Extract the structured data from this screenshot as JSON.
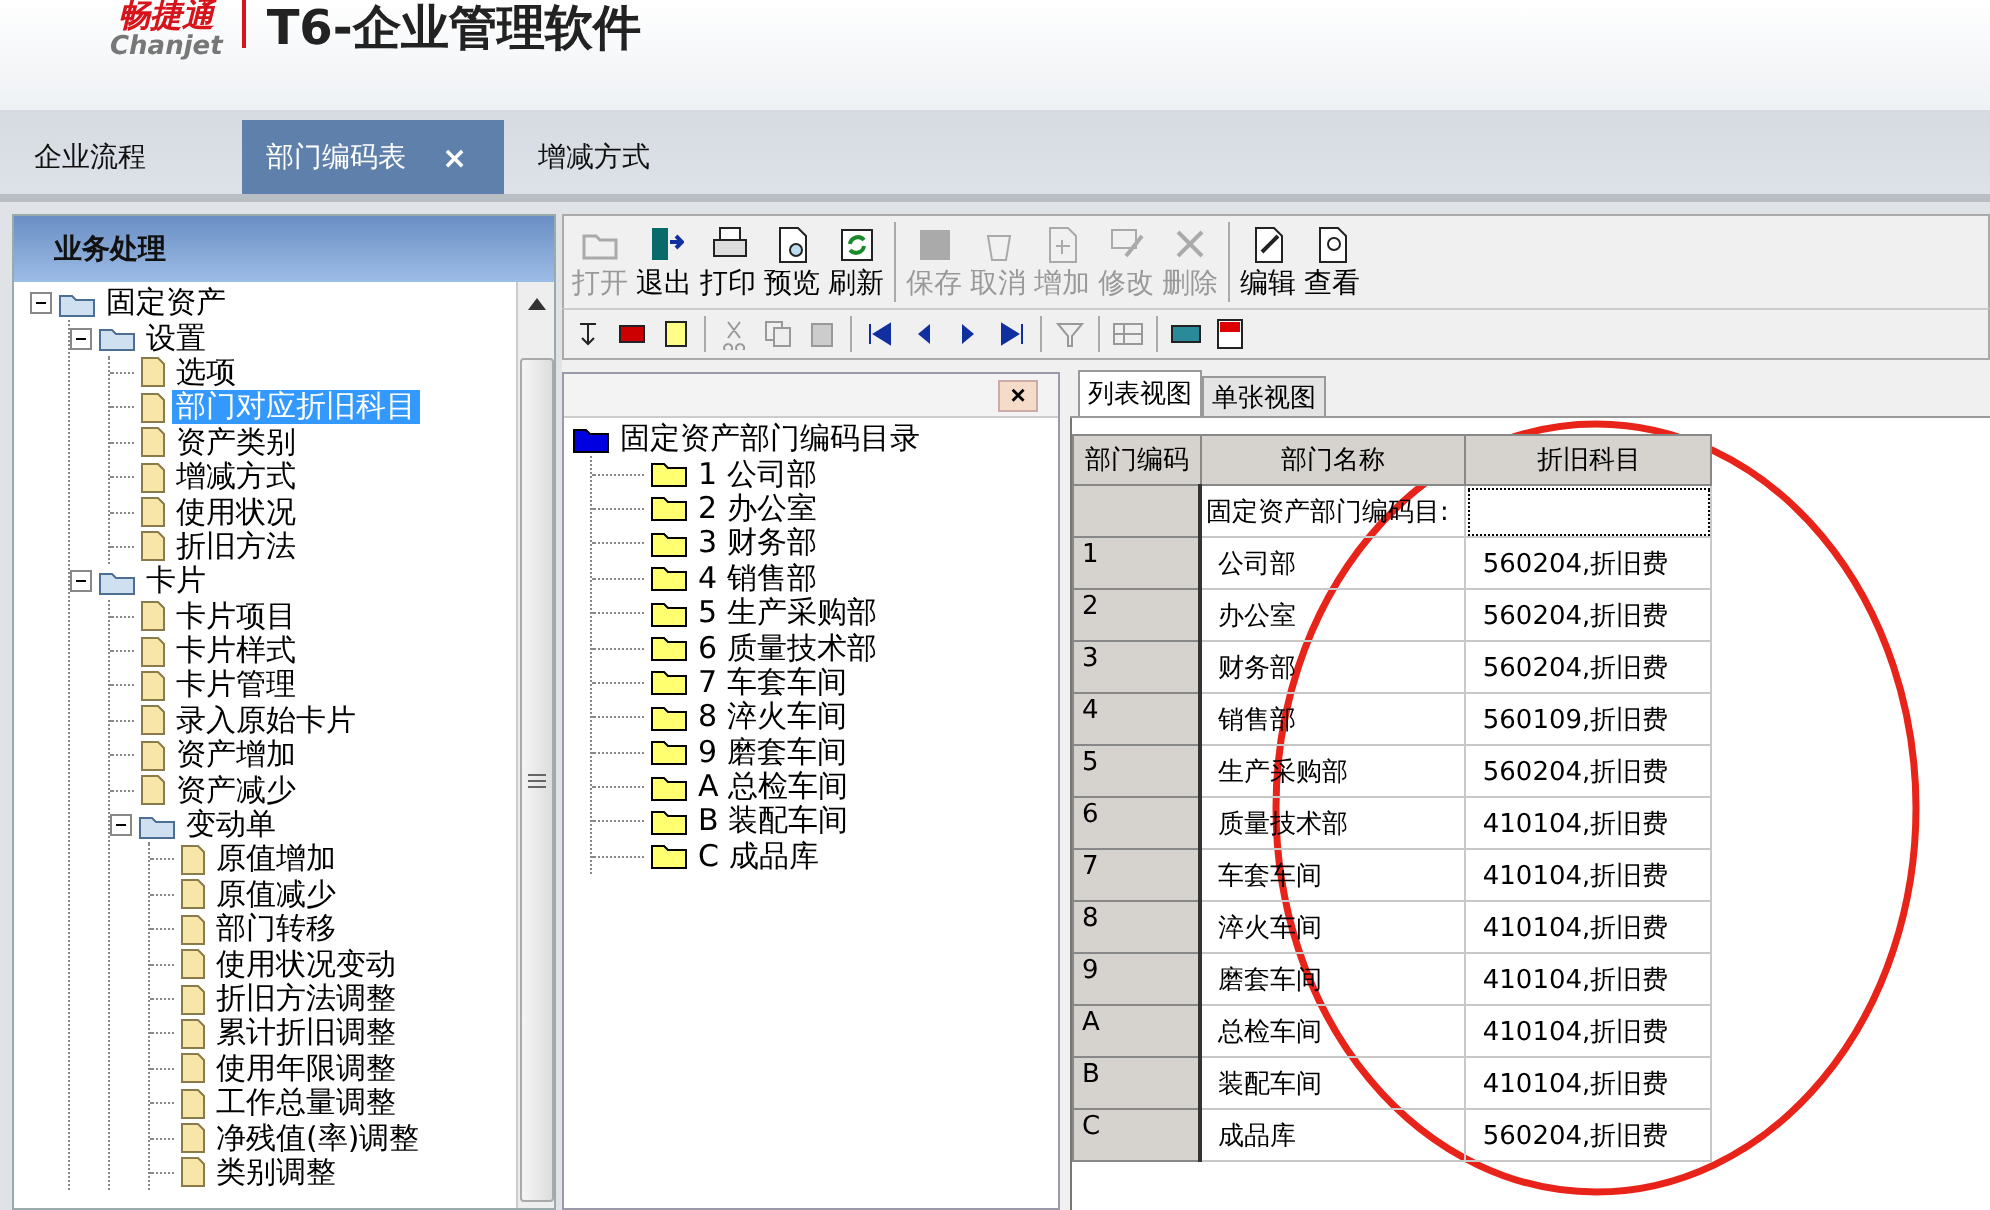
{
  "header": {
    "logo_cn": "畅捷通",
    "logo_en": "Chanjet",
    "product": "T6-企业管理软件"
  },
  "tabs": [
    {
      "label": "企业流程",
      "selected": false
    },
    {
      "label": "部门编码表",
      "selected": true,
      "close": "×"
    },
    {
      "label": "增减方式",
      "selected": false
    }
  ],
  "sidebar": {
    "title": "业务处理",
    "tree": [
      {
        "label": "固定资产",
        "kind": "folder",
        "expanded": true,
        "selected": false,
        "children": [
          {
            "label": "设置",
            "kind": "folder",
            "expanded": true,
            "selected": false,
            "children": [
              {
                "label": "选项",
                "kind": "doc",
                "selected": false
              },
              {
                "label": "部门对应折旧科目",
                "kind": "doc",
                "selected": true
              },
              {
                "label": "资产类别",
                "kind": "doc",
                "selected": false
              },
              {
                "label": "增减方式",
                "kind": "doc",
                "selected": false
              },
              {
                "label": "使用状况",
                "kind": "doc",
                "selected": false
              },
              {
                "label": "折旧方法",
                "kind": "doc",
                "selected": false
              }
            ]
          },
          {
            "label": "卡片",
            "kind": "folder",
            "expanded": true,
            "selected": false,
            "children": [
              {
                "label": "卡片项目",
                "kind": "doc",
                "selected": false
              },
              {
                "label": "卡片样式",
                "kind": "doc",
                "selected": false
              },
              {
                "label": "卡片管理",
                "kind": "doc",
                "selected": false
              },
              {
                "label": "录入原始卡片",
                "kind": "doc",
                "selected": false
              },
              {
                "label": "资产增加",
                "kind": "doc",
                "selected": false
              },
              {
                "label": "资产减少",
                "kind": "doc",
                "selected": false
              },
              {
                "label": "变动单",
                "kind": "folder",
                "expanded": true,
                "selected": false,
                "children": [
                  {
                    "label": "原值增加",
                    "kind": "doc",
                    "selected": false
                  },
                  {
                    "label": "原值减少",
                    "kind": "doc",
                    "selected": false
                  },
                  {
                    "label": "部门转移",
                    "kind": "doc",
                    "selected": false
                  },
                  {
                    "label": "使用状况变动",
                    "kind": "doc",
                    "selected": false
                  },
                  {
                    "label": "折旧方法调整",
                    "kind": "doc",
                    "selected": false
                  },
                  {
                    "label": "累计折旧调整",
                    "kind": "doc",
                    "selected": false
                  },
                  {
                    "label": "使用年限调整",
                    "kind": "doc",
                    "selected": false
                  },
                  {
                    "label": "工作总量调整",
                    "kind": "doc",
                    "selected": false
                  },
                  {
                    "label": "净残值(率)调整",
                    "kind": "doc",
                    "selected": false
                  },
                  {
                    "label": "类别调整",
                    "kind": "doc",
                    "selected": false
                  }
                ]
              }
            ]
          }
        ]
      }
    ]
  },
  "toolbar": [
    {
      "label": "打开",
      "disabled": true
    },
    {
      "label": "退出",
      "disabled": false
    },
    {
      "label": "打印",
      "disabled": false
    },
    {
      "label": "预览",
      "disabled": false
    },
    {
      "label": "刷新",
      "disabled": false
    },
    {
      "label": "保存",
      "disabled": true,
      "sep": true
    },
    {
      "label": "取消",
      "disabled": true
    },
    {
      "label": "增加",
      "disabled": true
    },
    {
      "label": "修改",
      "disabled": true
    },
    {
      "label": "删除",
      "disabled": true
    },
    {
      "label": "编辑",
      "disabled": false,
      "sep": true
    },
    {
      "label": "查看",
      "disabled": false
    }
  ],
  "dept_tree": {
    "close": "×",
    "root": "固定资产部门编码目录",
    "items": [
      {
        "code": "1",
        "name": "公司部"
      },
      {
        "code": "2",
        "name": "办公室"
      },
      {
        "code": "3",
        "name": "财务部"
      },
      {
        "code": "4",
        "name": "销售部"
      },
      {
        "code": "5",
        "name": "生产采购部"
      },
      {
        "code": "6",
        "name": "质量技术部"
      },
      {
        "code": "7",
        "name": "车套车间"
      },
      {
        "code": "8",
        "name": "淬火车间"
      },
      {
        "code": "9",
        "name": "磨套车间"
      },
      {
        "code": "A",
        "name": "总检车间"
      },
      {
        "code": "B",
        "name": "装配车间"
      },
      {
        "code": "C",
        "name": "成品库"
      }
    ]
  },
  "view_tabs": [
    {
      "label": "列表视图",
      "selected": true
    },
    {
      "label": "单张视图",
      "selected": false
    }
  ],
  "table": {
    "columns": [
      "部门编码",
      "部门名称",
      "折旧科目"
    ],
    "rows": [
      {
        "name": "固定资产部门编码目:",
        "focused": true
      },
      {
        "code": "1",
        "name": "公司部",
        "subject": "560204,折旧费",
        "focused": false
      },
      {
        "code": "2",
        "name": "办公室",
        "subject": "560204,折旧费",
        "focused": false
      },
      {
        "code": "3",
        "name": "财务部",
        "subject": "560204,折旧费",
        "focused": false
      },
      {
        "code": "4",
        "name": "销售部",
        "subject": "560109,折旧费",
        "focused": false
      },
      {
        "code": "5",
        "name": "生产采购部",
        "subject": "560204,折旧费",
        "focused": false
      },
      {
        "code": "6",
        "name": "质量技术部",
        "subject": "410104,折旧费",
        "focused": false
      },
      {
        "code": "7",
        "name": "车套车间",
        "subject": "410104,折旧费",
        "focused": false
      },
      {
        "code": "8",
        "name": "淬火车间",
        "subject": "410104,折旧费",
        "focused": false
      },
      {
        "code": "9",
        "name": "磨套车间",
        "subject": "410104,折旧费",
        "focused": false
      },
      {
        "code": "A",
        "name": "总检车间",
        "subject": "410104,折旧费",
        "focused": false
      },
      {
        "code": "B",
        "name": "装配车间",
        "subject": "410104,折旧费",
        "focused": false
      },
      {
        "code": "C",
        "name": "成品库",
        "subject": "560204,折旧费",
        "focused": false
      }
    ]
  }
}
